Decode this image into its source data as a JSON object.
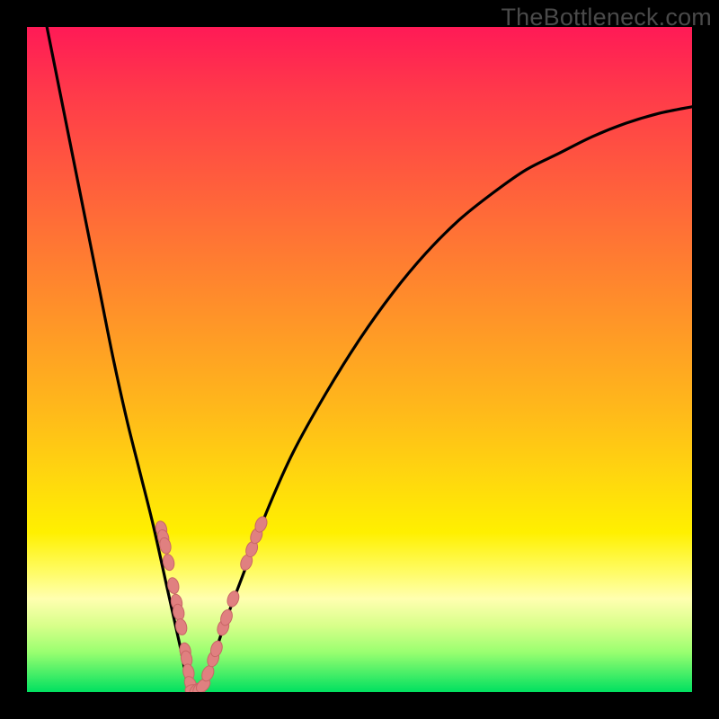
{
  "watermark": "TheBottleneck.com",
  "colors": {
    "gradient_top": "#ff1a56",
    "gradient_bottom": "#00e060",
    "curve": "#000000",
    "marker_fill": "#e08080",
    "marker_stroke": "#c86666"
  },
  "chart_data": {
    "type": "line",
    "title": "",
    "xlabel": "",
    "ylabel": "",
    "xlim": [
      0,
      1
    ],
    "ylim": [
      0,
      1
    ],
    "grid": false,
    "series": [
      {
        "name": "bottleneck-curve",
        "x": [
          0.03,
          0.05,
          0.07,
          0.09,
          0.11,
          0.13,
          0.15,
          0.17,
          0.19,
          0.21,
          0.23,
          0.24,
          0.245,
          0.25,
          0.26,
          0.27,
          0.28,
          0.3,
          0.33,
          0.36,
          0.4,
          0.45,
          0.5,
          0.55,
          0.6,
          0.65,
          0.7,
          0.75,
          0.8,
          0.85,
          0.9,
          0.95,
          1.0
        ],
        "y": [
          1.0,
          0.9,
          0.8,
          0.7,
          0.6,
          0.5,
          0.41,
          0.33,
          0.25,
          0.16,
          0.07,
          0.02,
          0.005,
          0.0,
          0.005,
          0.02,
          0.05,
          0.11,
          0.19,
          0.27,
          0.36,
          0.45,
          0.53,
          0.6,
          0.66,
          0.71,
          0.75,
          0.785,
          0.81,
          0.835,
          0.855,
          0.87,
          0.88
        ]
      }
    ],
    "markers": [
      {
        "x": 0.202,
        "y": 0.245
      },
      {
        "x": 0.205,
        "y": 0.232
      },
      {
        "x": 0.208,
        "y": 0.22
      },
      {
        "x": 0.213,
        "y": 0.195
      },
      {
        "x": 0.22,
        "y": 0.16
      },
      {
        "x": 0.225,
        "y": 0.135
      },
      {
        "x": 0.228,
        "y": 0.12
      },
      {
        "x": 0.232,
        "y": 0.098
      },
      {
        "x": 0.238,
        "y": 0.062
      },
      {
        "x": 0.24,
        "y": 0.05
      },
      {
        "x": 0.243,
        "y": 0.03
      },
      {
        "x": 0.246,
        "y": 0.012
      },
      {
        "x": 0.25,
        "y": 0.003
      },
      {
        "x": 0.255,
        "y": 0.003
      },
      {
        "x": 0.26,
        "y": 0.005
      },
      {
        "x": 0.265,
        "y": 0.01
      },
      {
        "x": 0.272,
        "y": 0.028
      },
      {
        "x": 0.28,
        "y": 0.05
      },
      {
        "x": 0.285,
        "y": 0.065
      },
      {
        "x": 0.295,
        "y": 0.097
      },
      {
        "x": 0.3,
        "y": 0.112
      },
      {
        "x": 0.31,
        "y": 0.14
      },
      {
        "x": 0.33,
        "y": 0.195
      },
      {
        "x": 0.338,
        "y": 0.215
      },
      {
        "x": 0.345,
        "y": 0.235
      },
      {
        "x": 0.352,
        "y": 0.252
      }
    ]
  }
}
